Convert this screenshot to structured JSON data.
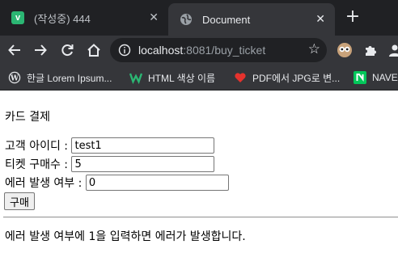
{
  "tabs": [
    {
      "favicon": "v-icon",
      "title": "(작성중) 444",
      "active": false
    },
    {
      "favicon": "globe-icon",
      "title": "Document",
      "active": true
    }
  ],
  "toolbar": {
    "url_host": "localhost",
    "url_rest": ":8081/buy_ticket"
  },
  "bookmarks": [
    {
      "icon": "wordpress-icon",
      "label": "한글 Lorem Ipsum..."
    },
    {
      "icon": "w-logo-icon",
      "label": "HTML 색상 이름"
    },
    {
      "icon": "heart-icon",
      "label": "PDF에서 JPG로 변..."
    },
    {
      "icon": "naver-icon",
      "label": "NAVER"
    }
  ],
  "page": {
    "title": "카드 결제",
    "fields": [
      {
        "label": "고객 아이디 : ",
        "value": "test1"
      },
      {
        "label": "티켓 구매수 : ",
        "value": "5"
      },
      {
        "label": "에러 발생 여부 : ",
        "value": "0"
      }
    ],
    "submit_label": "구매",
    "note": "에러 발생 여부에 1을 입력하면 에러가 발생합니다."
  },
  "colors": {
    "tabstrip": "#202124",
    "toolbar": "#35363a",
    "v_favicon": "#2bb673",
    "naver": "#03c75a"
  }
}
